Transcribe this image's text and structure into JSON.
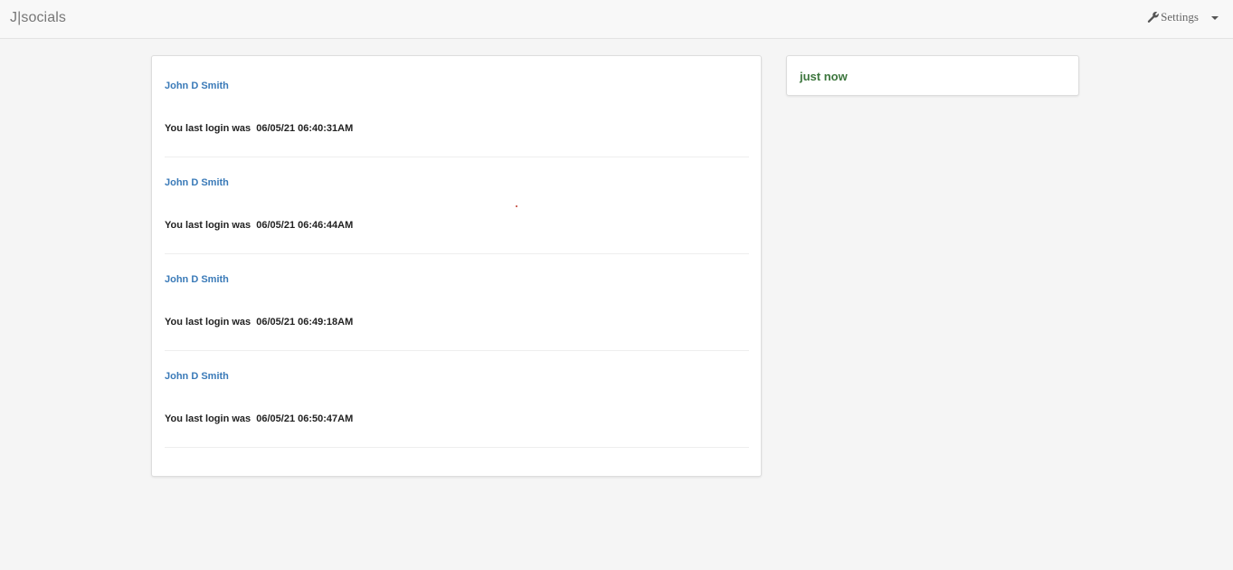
{
  "navbar": {
    "brand": "J|socials",
    "settings_label": "Settings",
    "settings_icon": "wrench-icon"
  },
  "feed": {
    "entries": [
      {
        "name": "John D Smith",
        "text_prefix": "You last login was  ",
        "timestamp": "06/05/21 06:40:31AM"
      },
      {
        "name": "John D Smith",
        "text_prefix": "You last login was  ",
        "timestamp": "06/05/21 06:46:44AM"
      },
      {
        "name": "John D Smith",
        "text_prefix": "You last login was  ",
        "timestamp": "06/05/21 06:49:18AM"
      },
      {
        "name": "John D Smith",
        "text_prefix": "You last login was  ",
        "timestamp": "06/05/21 06:50:47AM"
      }
    ]
  },
  "side_panel": {
    "text": "just now",
    "color": "#3c763d"
  },
  "colors": {
    "link": "#3a7ab8",
    "background": "#f5f5f5"
  }
}
